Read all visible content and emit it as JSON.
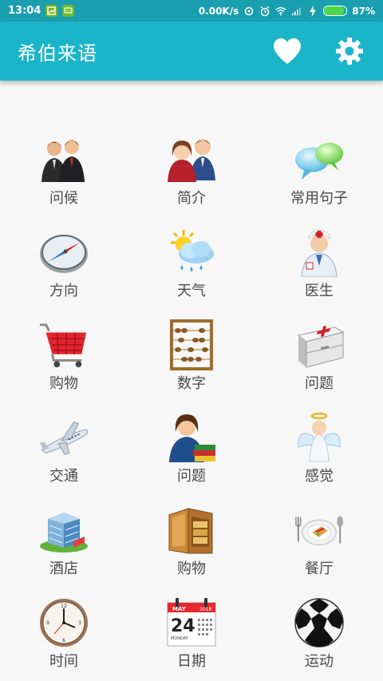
{
  "status_bar": {
    "time": "13:04",
    "net_speed": "0.00K/s",
    "battery_text": "87%",
    "battery_level": 0.87,
    "icons": [
      "image-notification-icon",
      "message-notification-icon",
      "sync-icon",
      "alarm-icon",
      "wifi-icon",
      "signal-icon",
      "charging-icon",
      "battery-icon"
    ]
  },
  "app_bar": {
    "title": "希伯来语",
    "actions": [
      "heart-icon",
      "gear-icon"
    ],
    "color": "#1bb5c9"
  },
  "categories": [
    {
      "label": "问候",
      "icon": "greeting-people-icon"
    },
    {
      "label": "简介",
      "icon": "couple-profile-icon"
    },
    {
      "label": "常用句子",
      "icon": "chat-bubbles-icon"
    },
    {
      "label": "方向",
      "icon": "compass-icon"
    },
    {
      "label": "天气",
      "icon": "weather-icon"
    },
    {
      "label": "医生",
      "icon": "doctor-icon"
    },
    {
      "label": "购物",
      "icon": "shopping-cart-icon"
    },
    {
      "label": "数字",
      "icon": "abacus-icon"
    },
    {
      "label": "问题",
      "icon": "first-aid-kit-icon"
    },
    {
      "label": "交通",
      "icon": "airplane-icon"
    },
    {
      "label": "问题",
      "icon": "teacher-books-icon"
    },
    {
      "label": "感觉",
      "icon": "angel-icon"
    },
    {
      "label": "酒店",
      "icon": "hotel-building-icon"
    },
    {
      "label": "购物",
      "icon": "wallet-icon"
    },
    {
      "label": "餐厅",
      "icon": "dinner-plate-icon"
    },
    {
      "label": "时间",
      "icon": "clock-icon"
    },
    {
      "label": "日期",
      "icon": "calendar-icon"
    },
    {
      "label": "运动",
      "icon": "soccer-ball-icon"
    }
  ],
  "calendar_icon": {
    "month": "MAY",
    "year": "2018",
    "day": "24",
    "weekday": "MONDAY"
  }
}
